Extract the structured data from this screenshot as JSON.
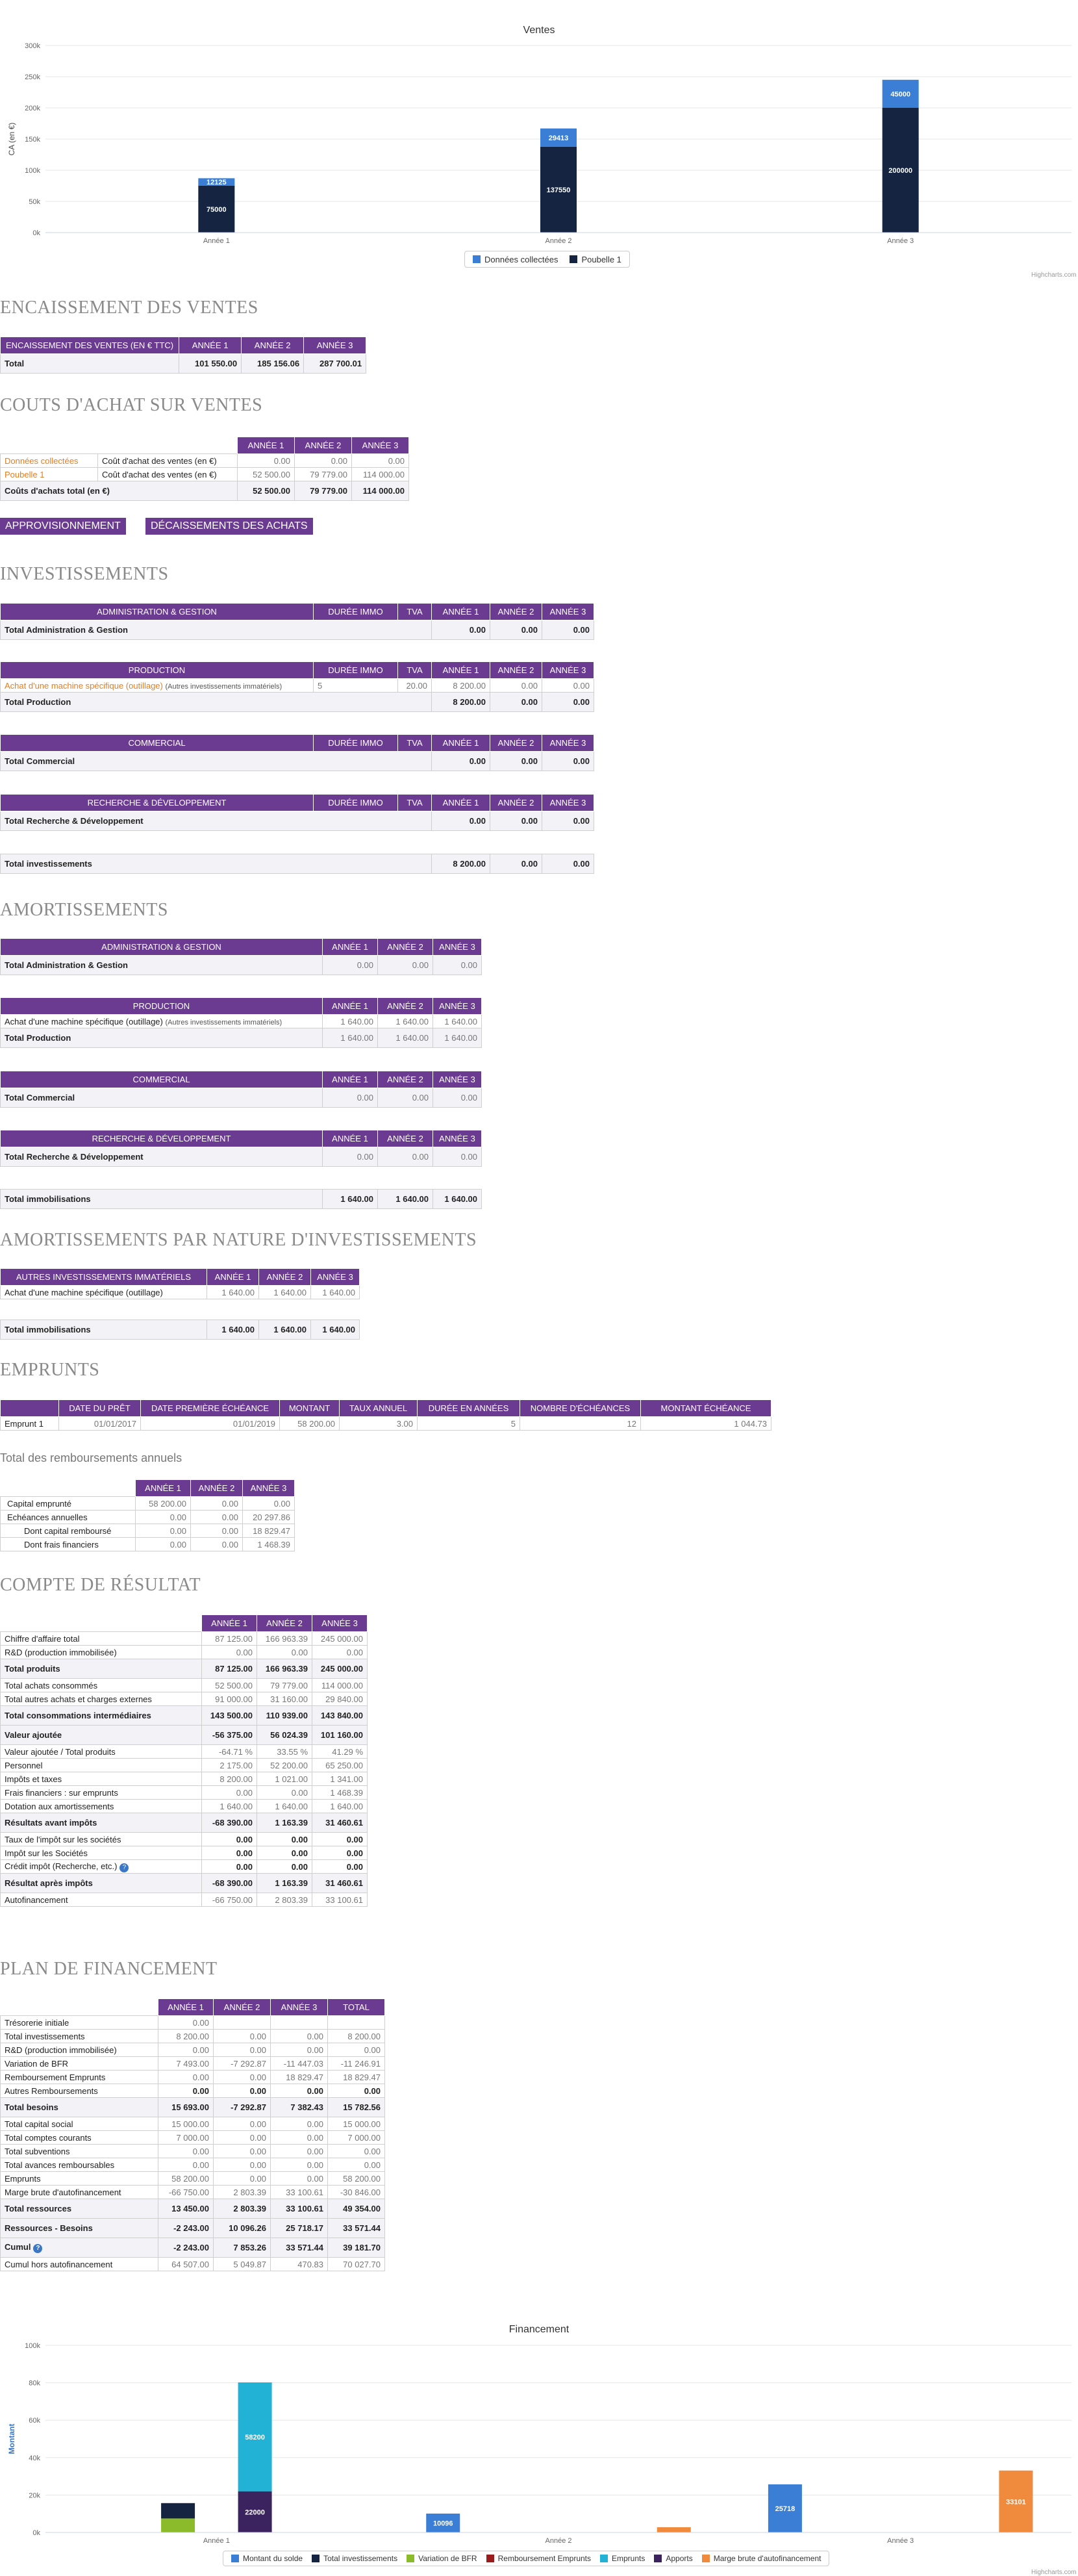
{
  "sales_chart": {
    "title": "Ventes",
    "ylabel": "CA (en €)",
    "credit": "Highcharts.com",
    "legend": [
      "Données collectées",
      "Poubelle 1"
    ],
    "legend_colors": [
      "#3a7fd5",
      "#1a2b47"
    ]
  },
  "chart_data": [
    {
      "type": "bar",
      "title": "Ventes",
      "ylabel": "CA (en €)",
      "categories": [
        "Année 1",
        "Année 2",
        "Année 3"
      ],
      "ylim": [
        0,
        300000
      ],
      "yticks": [
        "0k",
        "50k",
        "100k",
        "150k",
        "200k",
        "250k",
        "300k"
      ],
      "stacked": true,
      "series": [
        {
          "name": "Données collectées",
          "values": [
            12125,
            29413,
            45000
          ],
          "color": "#3a7fd5"
        },
        {
          "name": "Poubelle 1",
          "values": [
            75000,
            137550,
            200000
          ],
          "color": "#152440"
        }
      ],
      "legend": "bottom-center"
    },
    {
      "type": "bar",
      "title": "Financement",
      "ylabel": "Montant",
      "categories": [
        "Année 1",
        "Année 2",
        "Année 3"
      ],
      "ylim": [
        0,
        100000
      ],
      "yticks": [
        "0k",
        "20k",
        "40k",
        "60k",
        "80k",
        "100k"
      ],
      "series": [
        {
          "name": "Montant du solde",
          "values": [
            0,
            10096,
            25718
          ],
          "color": "#3a7fd5"
        },
        {
          "name": "Total investissements",
          "values": [
            8200,
            0,
            0
          ],
          "color": "#152440"
        },
        {
          "name": "Variation de BFR",
          "values": [
            7493,
            0,
            0
          ],
          "color": "#8bbb2a"
        },
        {
          "name": "Remboursement Emprunts",
          "values": [
            0,
            0,
            0
          ],
          "color": "#9b1c1c"
        },
        {
          "name": "Emprunts",
          "values": [
            58200,
            0,
            0
          ],
          "color": "#22b2d6"
        },
        {
          "name": "Apports",
          "values": [
            22000,
            0,
            0
          ],
          "color": "#3b2360"
        },
        {
          "name": "Marge brute d'autofinancement",
          "values": [
            0,
            2803,
            33101
          ],
          "color": "#f08a3c"
        }
      ],
      "bar_labels": [
        [
          "8200",
          "58200",
          "22000"
        ],
        [
          "10096"
        ],
        [
          "25718",
          "33101"
        ]
      ],
      "legend": "bottom-center"
    }
  ],
  "encaissement": {
    "title": "ENCAISSEMENT DES VENTES",
    "headers": [
      "ENCAISSEMENT DES VENTES (EN € TTC)",
      "ANNÉE 1",
      "ANNÉE 2",
      "ANNÉE 3"
    ],
    "total": [
      "Total",
      "101 550.00",
      "185 156.06",
      "287 700.01"
    ]
  },
  "couts": {
    "title": "COUTS D'ACHAT SUR VENTES",
    "headers": [
      "ANNÉE 1",
      "ANNÉE 2",
      "ANNÉE 3"
    ],
    "rows": [
      [
        "Données collectées",
        "Coût d'achat des ventes (en €)",
        "0.00",
        "0.00",
        "0.00"
      ],
      [
        "Poubelle 1",
        "Coût d'achat des ventes (en €)",
        "52 500.00",
        "79 779.00",
        "114 000.00"
      ]
    ],
    "total": [
      "Coûts d'achats total (en €)",
      "52 500.00",
      "79 779.00",
      "114 000.00"
    ],
    "btn_appro": "APPROVISIONNEMENT",
    "btn_decaiss": "DÉCAISSEMENTS DES ACHATS"
  },
  "investissements": {
    "title": "INVESTISSEMENTS",
    "cols": [
      "DURÉE IMMO",
      "TVA",
      "ANNÉE 1",
      "ANNÉE 2",
      "ANNÉE 3"
    ],
    "admin": {
      "head": "ADMINISTRATION & GESTION",
      "total": [
        "Total Administration & Gestion",
        "0.00",
        "0.00",
        "0.00"
      ]
    },
    "prod": {
      "head": "PRODUCTION",
      "row": [
        "Achat d'une machine spécifique (outillage)",
        "(Autres investissements immatériels)",
        "5",
        "20.00",
        "8 200.00",
        "0.00",
        "0.00"
      ],
      "total": [
        "Total Production",
        "8 200.00",
        "0.00",
        "0.00"
      ]
    },
    "comm": {
      "head": "COMMERCIAL",
      "total": [
        "Total Commercial",
        "0.00",
        "0.00",
        "0.00"
      ]
    },
    "rd": {
      "head": "RECHERCHE & DÉVELOPPEMENT",
      "total": [
        "Total Recherche & Développement",
        "0.00",
        "0.00",
        "0.00"
      ]
    },
    "grand": [
      "Total investissements",
      "8 200.00",
      "0.00",
      "0.00"
    ]
  },
  "amort": {
    "title": "AMORTISSEMENTS",
    "cols": [
      "ANNÉE 1",
      "ANNÉE 2",
      "ANNÉE 3"
    ],
    "admin": {
      "head": "ADMINISTRATION & GESTION",
      "total": [
        "Total Administration & Gestion",
        "0.00",
        "0.00",
        "0.00"
      ]
    },
    "prod": {
      "head": "PRODUCTION",
      "row": [
        "Achat d'une machine spécifique (outillage)",
        "(Autres investissements immatériels)",
        "1 640.00",
        "1 640.00",
        "1 640.00"
      ],
      "total": [
        "Total Production",
        "1 640.00",
        "1 640.00",
        "1 640.00"
      ]
    },
    "comm": {
      "head": "COMMERCIAL",
      "total": [
        "Total Commercial",
        "0.00",
        "0.00",
        "0.00"
      ]
    },
    "rd": {
      "head": "RECHERCHE & DÉVELOPPEMENT",
      "total": [
        "Total Recherche & Développement",
        "0.00",
        "0.00",
        "0.00"
      ]
    },
    "grand": [
      "Total immobilisations",
      "1 640.00",
      "1 640.00",
      "1 640.00"
    ]
  },
  "amort_nature": {
    "title": "AMORTISSEMENTS PAR NATURE D'INVESTISSEMENTS",
    "headers": [
      "AUTRES INVESTISSEMENTS IMMATÉRIELS",
      "ANNÉE 1",
      "ANNÉE 2",
      "ANNÉE 3"
    ],
    "row": [
      "Achat d'une machine spécifique (outillage)",
      "1 640.00",
      "1 640.00",
      "1 640.00"
    ],
    "total": [
      "Total immobilisations",
      "1 640.00",
      "1 640.00",
      "1 640.00"
    ]
  },
  "emprunts": {
    "title": "EMPRUNTS",
    "headers": [
      "",
      "DATE DU PRÊT",
      "DATE PREMIÈRE ÉCHÉANCE",
      "MONTANT",
      "TAUX ANNUEL",
      "DURÉE EN ANNÉES",
      "NOMBRE D'ÉCHÉANCES",
      "MONTANT ÉCHÉANCE"
    ],
    "row": [
      "Emprunt 1",
      "01/01/2017",
      "01/01/2019",
      "58 200.00",
      "3.00",
      "5",
      "12",
      "1 044.73"
    ],
    "subtitle": "Total des remboursements annuels",
    "rem_headers": [
      "",
      "ANNÉE 1",
      "ANNÉE 2",
      "ANNÉE 3"
    ],
    "rem_rows": [
      [
        "Capital emprunté",
        "58 200.00",
        "0.00",
        "0.00"
      ],
      [
        "Echéances annuelles",
        "0.00",
        "0.00",
        "20 297.86"
      ],
      [
        "Dont capital remboursé",
        "0.00",
        "0.00",
        "18 829.47"
      ],
      [
        "Dont frais financiers",
        "0.00",
        "0.00",
        "1 468.39"
      ]
    ]
  },
  "resultat": {
    "title": "COMPTE DE RÉSULTAT",
    "headers": [
      "",
      "ANNÉE 1",
      "ANNÉE 2",
      "ANNÉE 3"
    ],
    "rows": [
      [
        "Chiffre d'affaire total",
        "87 125.00",
        "166 963.39",
        "245 000.00",
        "n"
      ],
      [
        "R&D (production immobilisée)",
        "0.00",
        "0.00",
        "0.00",
        "n"
      ],
      [
        "Total produits",
        "87 125.00",
        "166 963.39",
        "245 000.00",
        "t"
      ],
      [
        "Total achats consommés",
        "52 500.00",
        "79 779.00",
        "114 000.00",
        "n"
      ],
      [
        "Total autres achats et charges externes",
        "91 000.00",
        "31 160.00",
        "29 840.00",
        "n"
      ],
      [
        "Total consommations intermédiaires",
        "143 500.00",
        "110 939.00",
        "143 840.00",
        "t"
      ],
      [
        "Valeur ajoutée",
        "-56 375.00",
        "56 024.39",
        "101 160.00",
        "t"
      ],
      [
        "Valeur ajoutée / Total produits",
        "-64.71 %",
        "33.55 %",
        "41.29 %",
        "n"
      ],
      [
        "Personnel",
        "2 175.00",
        "52 200.00",
        "65 250.00",
        "n"
      ],
      [
        "Impôts et taxes",
        "8 200.00",
        "1 021.00",
        "1 341.00",
        "n"
      ],
      [
        "Frais financiers : sur emprunts",
        "0.00",
        "0.00",
        "1 468.39",
        "n"
      ],
      [
        "Dotation aux amortissements",
        "1 640.00",
        "1 640.00",
        "1 640.00",
        "n"
      ],
      [
        "Résultats avant impôts",
        "-68 390.00",
        "1 163.39",
        "31 460.61",
        "t"
      ],
      [
        "Taux de l'impôt sur les sociétés",
        "0.00",
        "0.00",
        "0.00",
        "b"
      ],
      [
        "Impôt sur les Sociétés",
        "0.00",
        "0.00",
        "0.00",
        "b"
      ],
      [
        "Crédit impôt (Recherche, etc.)",
        "0.00",
        "0.00",
        "0.00",
        "b"
      ],
      [
        "Résultat après impôts",
        "-68 390.00",
        "1 163.39",
        "31 460.61",
        "t"
      ],
      [
        "Autofinancement",
        "-66 750.00",
        "2 803.39",
        "33 100.61",
        "n"
      ]
    ]
  },
  "plan": {
    "title": "PLAN DE FINANCEMENT",
    "headers": [
      "",
      "ANNÉE 1",
      "ANNÉE 2",
      "ANNÉE 3",
      "TOTAL"
    ],
    "rows": [
      [
        "Trésorerie initiale",
        "0.00",
        "",
        "",
        "",
        "n"
      ],
      [
        "Total investissements",
        "8 200.00",
        "0.00",
        "0.00",
        "8 200.00",
        "n"
      ],
      [
        "R&D (production immobilisée)",
        "0.00",
        "0.00",
        "0.00",
        "0.00",
        "n"
      ],
      [
        "Variation de BFR",
        "7 493.00",
        "-7 292.87",
        "-11 447.03",
        "-11 246.91",
        "n"
      ],
      [
        "Remboursement Emprunts",
        "0.00",
        "0.00",
        "18 829.47",
        "18 829.47",
        "n"
      ],
      [
        "Autres Remboursements",
        "0.00",
        "0.00",
        "0.00",
        "0.00",
        "b"
      ],
      [
        "Total besoins",
        "15 693.00",
        "-7 292.87",
        "7 382.43",
        "15 782.56",
        "t"
      ],
      [
        "Total capital social",
        "15 000.00",
        "0.00",
        "0.00",
        "15 000.00",
        "n"
      ],
      [
        "Total comptes courants",
        "7 000.00",
        "0.00",
        "0.00",
        "7 000.00",
        "n"
      ],
      [
        "Total subventions",
        "0.00",
        "0.00",
        "0.00",
        "0.00",
        "n"
      ],
      [
        "Total avances remboursables",
        "0.00",
        "0.00",
        "0.00",
        "0.00",
        "n"
      ],
      [
        "Emprunts",
        "58 200.00",
        "0.00",
        "0.00",
        "58 200.00",
        "n"
      ],
      [
        "Marge brute d'autofinancement",
        "-66 750.00",
        "2 803.39",
        "33 100.61",
        "-30 846.00",
        "n"
      ],
      [
        "Total ressources",
        "13 450.00",
        "2 803.39",
        "33 100.61",
        "49 354.00",
        "t"
      ],
      [
        "Ressources - Besoins",
        "-2 243.00",
        "10 096.26",
        "25 718.17",
        "33 571.44",
        "t"
      ],
      [
        "Cumul",
        "-2 243.00",
        "7 853.26",
        "33 571.44",
        "39 181.70",
        "t"
      ],
      [
        "Cumul hors autofinancement",
        "64 507.00",
        "5 049.87",
        "470.83",
        "70 027.70",
        "n"
      ]
    ]
  },
  "fin_chart": {
    "title": "Financement",
    "ylabel": "Montant",
    "credit": "Highcharts.com"
  }
}
